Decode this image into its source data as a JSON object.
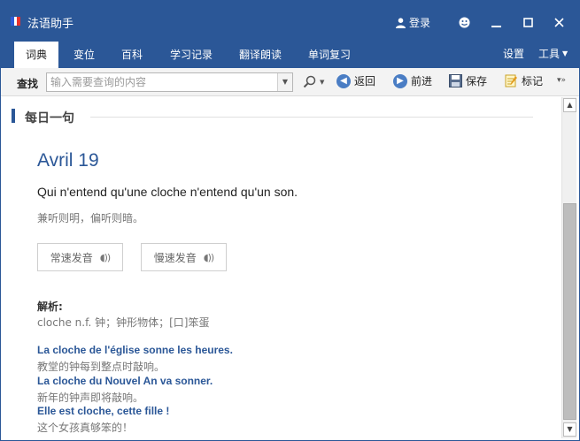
{
  "app": {
    "title": "法语助手",
    "login_label": "登录"
  },
  "tabs": [
    {
      "label": "词典",
      "active": true
    },
    {
      "label": "变位"
    },
    {
      "label": "百科"
    },
    {
      "label": "学习记录"
    },
    {
      "label": "翻译朗读"
    },
    {
      "label": "单词复习"
    }
  ],
  "tabs_right": {
    "settings": "设置",
    "tools": "工具"
  },
  "toolbar": {
    "search_label": "查找",
    "search_placeholder": "输入需要查询的内容",
    "back": "返回",
    "forward": "前进",
    "save": "保存",
    "mark": "标记"
  },
  "daily": {
    "section_title": "每日一句",
    "date": "Avril 19",
    "sentence": "Qui n'entend qu'une cloche n'entend qu'un son.",
    "translation": "兼听则明，偏听则暗。",
    "normal_speed": "常速发音",
    "slow_speed": "慢速发音",
    "analysis_label": "解析:",
    "analysis_text": "cloche n.f. 钟；钟形物体；[口]笨蛋",
    "examples": [
      {
        "fr": "La cloche de l'église sonne les heures.",
        "cn": "教堂的钟每到整点时敲响。"
      },
      {
        "fr": "La cloche du Nouvel An va sonner.",
        "cn": "新年的钟声即将敲响。"
      },
      {
        "fr": "Elle est cloche, cette fille !",
        "cn": "这个女孩真够笨的！"
      }
    ]
  },
  "colors": {
    "brand": "#2b5797",
    "flag_blue": "#2e5bd8",
    "flag_red": "#e8322e"
  }
}
